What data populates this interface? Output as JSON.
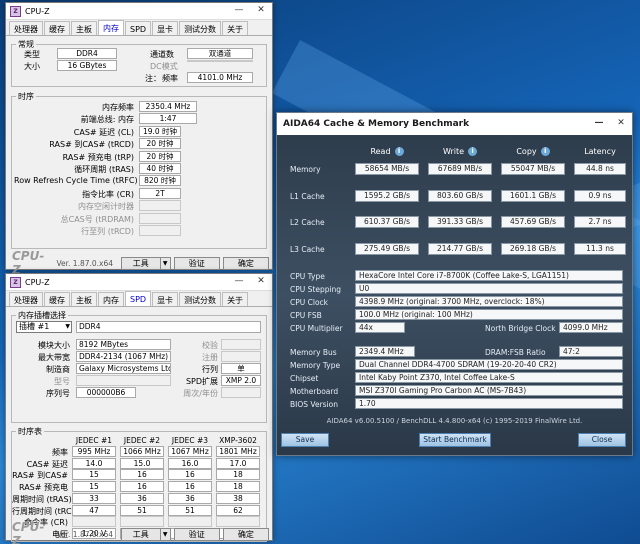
{
  "cpuz_common": {
    "title": "CPU-Z",
    "version": "Ver. 1.87.0.x64",
    "tools_label": "工具",
    "validate_label": "验证",
    "ok_label": "确定",
    "brand": "CPU-Z",
    "tabs": [
      "处理器",
      "缓存",
      "主板",
      "内存",
      "SPD",
      "显卡",
      "测试分数",
      "关于"
    ]
  },
  "memory": {
    "active_tab": "内存",
    "general": {
      "title": "常规",
      "type_label": "类型",
      "type": "DDR4",
      "size_label": "大小",
      "size": "16 GBytes",
      "channels_label": "通道数",
      "channels": "双通道",
      "dc_mode_label": "DC模式",
      "nb_freq_label_prefix": "注：",
      "nb_freq_label": "频率",
      "nb_freq": "4101.0 MHz"
    },
    "timings": {
      "title": "时序",
      "rows": [
        {
          "label": "内存频率",
          "value": "2350.4 MHz",
          "dim": false
        },
        {
          "label": "前端总线: 内存",
          "value": "1:47",
          "dim": false
        },
        {
          "label": "CAS# 延迟 (CL)",
          "value": "19.0 时钟",
          "dim": false
        },
        {
          "label": "RAS# 到CAS# (tRCD)",
          "value": "20 时钟",
          "dim": false
        },
        {
          "label": "RAS# 预充电 (tRP)",
          "value": "20 时钟",
          "dim": false
        },
        {
          "label": "循环周期 (tRAS)",
          "value": "40 时钟",
          "dim": false
        },
        {
          "label": "Row Refresh Cycle Time (tRFC)",
          "value": "820 时钟",
          "dim": false
        },
        {
          "label": "指令比率 (CR)",
          "value": "2T",
          "dim": false
        },
        {
          "label": "内存空闲计时器",
          "value": "",
          "dim": true
        },
        {
          "label": "总CAS号 (tRDRAM)",
          "value": "",
          "dim": true
        },
        {
          "label": "行至列 (tRCD)",
          "value": "",
          "dim": true
        }
      ]
    }
  },
  "spd": {
    "active_tab": "SPD",
    "slot_group_title": "内存插槽选择",
    "slot": "插槽 #1",
    "slot_type": "DDR4",
    "module_size_label": "模块大小",
    "module_size": "8192 MBytes",
    "max_bw_label": "最大带宽",
    "max_bw": "DDR4-2134 (1067 MHz)",
    "maker_label": "制造商",
    "maker": "Galaxy Microsystems Ltd.",
    "model_label": "型号",
    "serial_label": "序列号",
    "serial": "000000B6",
    "ecc_label": "校验",
    "registered_label": "注册",
    "ranks_label": "行列",
    "ranks": "单",
    "spd_ext_label": "SPD扩展",
    "spd_ext": "XMP 2.0",
    "week_year_label": "周次/年份",
    "timing_table": {
      "title": "时序表",
      "columns": [
        "JEDEC #1",
        "JEDEC #2",
        "JEDEC #3",
        "XMP-3602"
      ],
      "rows": [
        {
          "label": "频率",
          "values": [
            "995 MHz",
            "1066 MHz",
            "1067 MHz",
            "1801 MHz"
          ]
        },
        {
          "label": "CAS# 延迟",
          "values": [
            "14.0",
            "15.0",
            "16.0",
            "17.0"
          ]
        },
        {
          "label": "RAS# 到CAS#",
          "values": [
            "15",
            "16",
            "16",
            "18"
          ]
        },
        {
          "label": "RAS# 预充电",
          "values": [
            "15",
            "16",
            "16",
            "18"
          ]
        },
        {
          "label": "周期时间 (tRAS)",
          "values": [
            "33",
            "36",
            "36",
            "38"
          ]
        },
        {
          "label": "行周期时间 (tRC)",
          "values": [
            "47",
            "51",
            "51",
            "62"
          ]
        },
        {
          "label": "命令率 (CR)",
          "values": [
            "",
            "",
            "",
            ""
          ]
        },
        {
          "label": "电压",
          "values": [
            "1.20 V",
            "1.20 V",
            "1.20 V",
            "1.350 V"
          ]
        }
      ]
    }
  },
  "aida": {
    "title": "AIDA64 Cache & Memory Benchmark",
    "col_headers": [
      "Read",
      "Write",
      "Copy",
      "Latency"
    ],
    "bench_rows": [
      {
        "label": "Memory",
        "values": [
          "58654 MB/s",
          "67689 MB/s",
          "55047 MB/s",
          "44.8 ns"
        ]
      },
      {
        "label": "L1 Cache",
        "values": [
          "1595.2 GB/s",
          "803.60 GB/s",
          "1601.1 GB/s",
          "0.9 ns"
        ]
      },
      {
        "label": "L2 Cache",
        "values": [
          "610.37 GB/s",
          "391.33 GB/s",
          "457.69 GB/s",
          "2.7 ns"
        ]
      },
      {
        "label": "L3 Cache",
        "values": [
          "275.49 GB/s",
          "214.77 GB/s",
          "269.18 GB/s",
          "11.3 ns"
        ]
      }
    ],
    "cpu_type_label": "CPU Type",
    "cpu_type": "HexaCore Intel Core i7-8700K  (Coffee Lake-S, LGA1151)",
    "cpu_stepping_label": "CPU Stepping",
    "cpu_stepping": "U0",
    "cpu_clock_label": "CPU Clock",
    "cpu_clock": "4398.9 MHz  (original: 3700 MHz, overclock: 18%)",
    "cpu_fsb_label": "CPU FSB",
    "cpu_fsb": "100.0 MHz  (original: 100 MHz)",
    "cpu_mult_label": "CPU Multiplier",
    "cpu_mult": "44x",
    "nb_clock_label": "North Bridge Clock",
    "nb_clock": "4099.0 MHz",
    "mem_bus_label": "Memory Bus",
    "mem_bus": "2349.4 MHz",
    "dram_fsb_label": "DRAM:FSB Ratio",
    "dram_fsb": "47:2",
    "mem_type_label": "Memory Type",
    "mem_type": "Dual Channel DDR4-4700 SDRAM  (19-20-20-40 CR2)",
    "chipset_label": "Chipset",
    "chipset": "Intel Kaby Point Z370, Intel Coffee Lake-S",
    "mobo_label": "Motherboard",
    "mobo": "MSI Z370I Gaming Pro Carbon AC (MS-7B43)",
    "bios_label": "BIOS Version",
    "bios": "1.70",
    "version_line": "AIDA64 v6.00.5100 / BenchDLL 4.4.800-x64  (c) 1995-2019 FinalWire Ltd.",
    "save_label": "Save",
    "start_label": "Start Benchmark",
    "close_label": "Close"
  }
}
